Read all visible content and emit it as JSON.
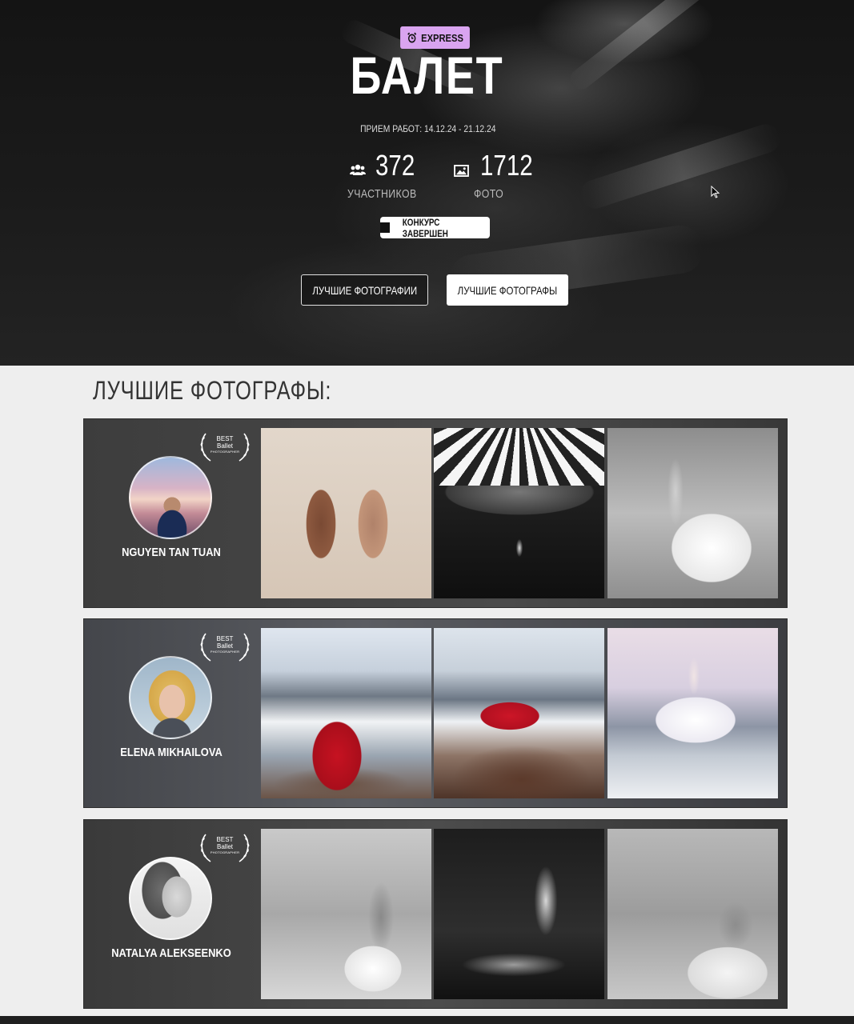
{
  "hero": {
    "badge": "EXPRESS",
    "title": "БАЛЕТ",
    "dates": "ПРИЕМ РАБОТ: 14.12.24 - 21.12.24",
    "stats": {
      "participants": {
        "value": "372",
        "label": "УЧАСТНИКОВ",
        "icon": "users-icon"
      },
      "photos": {
        "value": "1712",
        "label": "ФОТО",
        "icon": "image-icon"
      }
    },
    "status": "КОНКУРС ЗАВЕРШЕН",
    "buttons": {
      "best_photos": "ЛУЧШИЕ ФОТОГРАФИИ",
      "best_photographers": "ЛУЧШИЕ ФОТОГРАФЫ"
    }
  },
  "section": {
    "title": "ЛУЧШИЕ ФОТОГРАФЫ:",
    "award": {
      "line1": "BEST",
      "line2": "Ballet",
      "line3": "PHOTOGRAPHER"
    },
    "photographers": [
      {
        "name": "NGUYEN TAN TUAN"
      },
      {
        "name": "ELENA MIKHAILOVA"
      },
      {
        "name": "NATALYA ALEKSEENKO"
      }
    ]
  },
  "colors": {
    "badge": "#d9a4f0",
    "hero_bg": "#141414",
    "page_bg": "#eeeeee",
    "row_bg": "#3e3e3e"
  }
}
